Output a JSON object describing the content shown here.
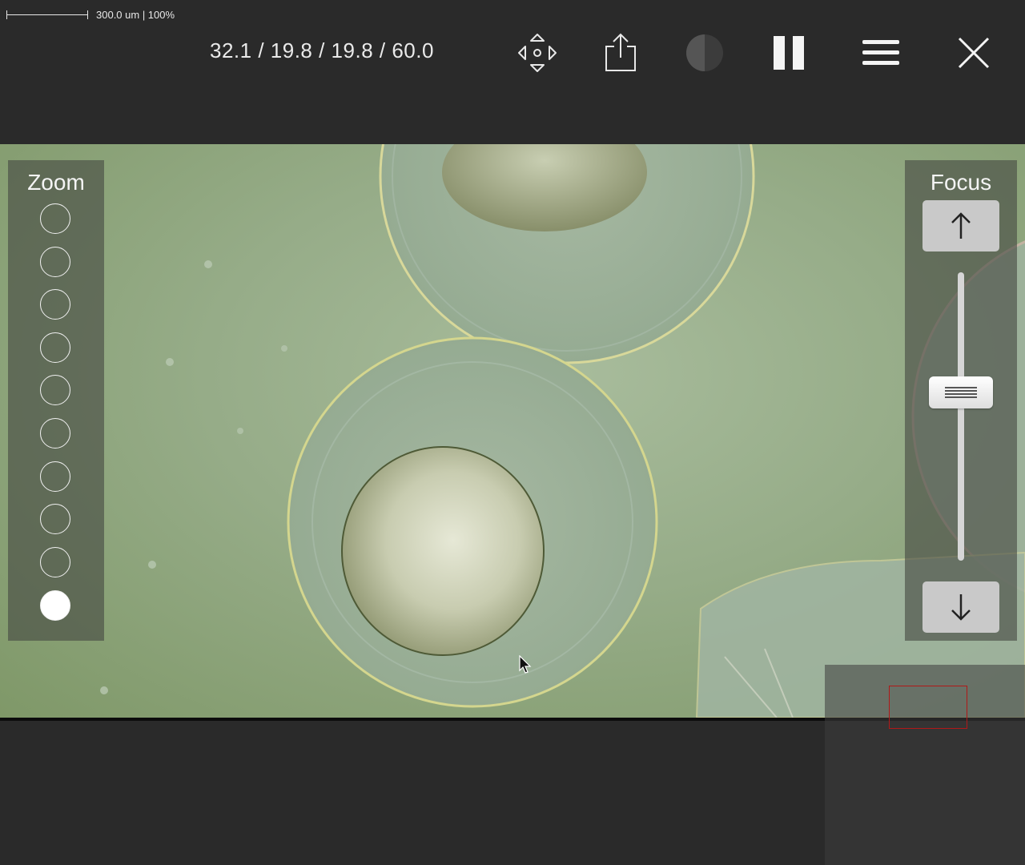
{
  "scale": {
    "text": "300.0 um | 100%"
  },
  "toolbar": {
    "coordinates": "32.1 / 19.8 / 19.8 / 60.0",
    "icons": [
      "move-icon",
      "share-icon",
      "contrast-icon",
      "pause-icon",
      "menu-icon",
      "close-icon"
    ]
  },
  "zoom": {
    "title": "Zoom",
    "levels": 10,
    "selected_level": 10
  },
  "focus": {
    "title": "Focus",
    "up_icon": "arrow-up-icon",
    "down_icon": "arrow-down-icon",
    "slider_value_fraction": 0.42
  },
  "minimap": {
    "indicator_color": "#b01818"
  },
  "colors": {
    "background": "#2a2a2a",
    "panel": "rgba(70,72,66,0.62)",
    "specimen": "#96ac88"
  }
}
